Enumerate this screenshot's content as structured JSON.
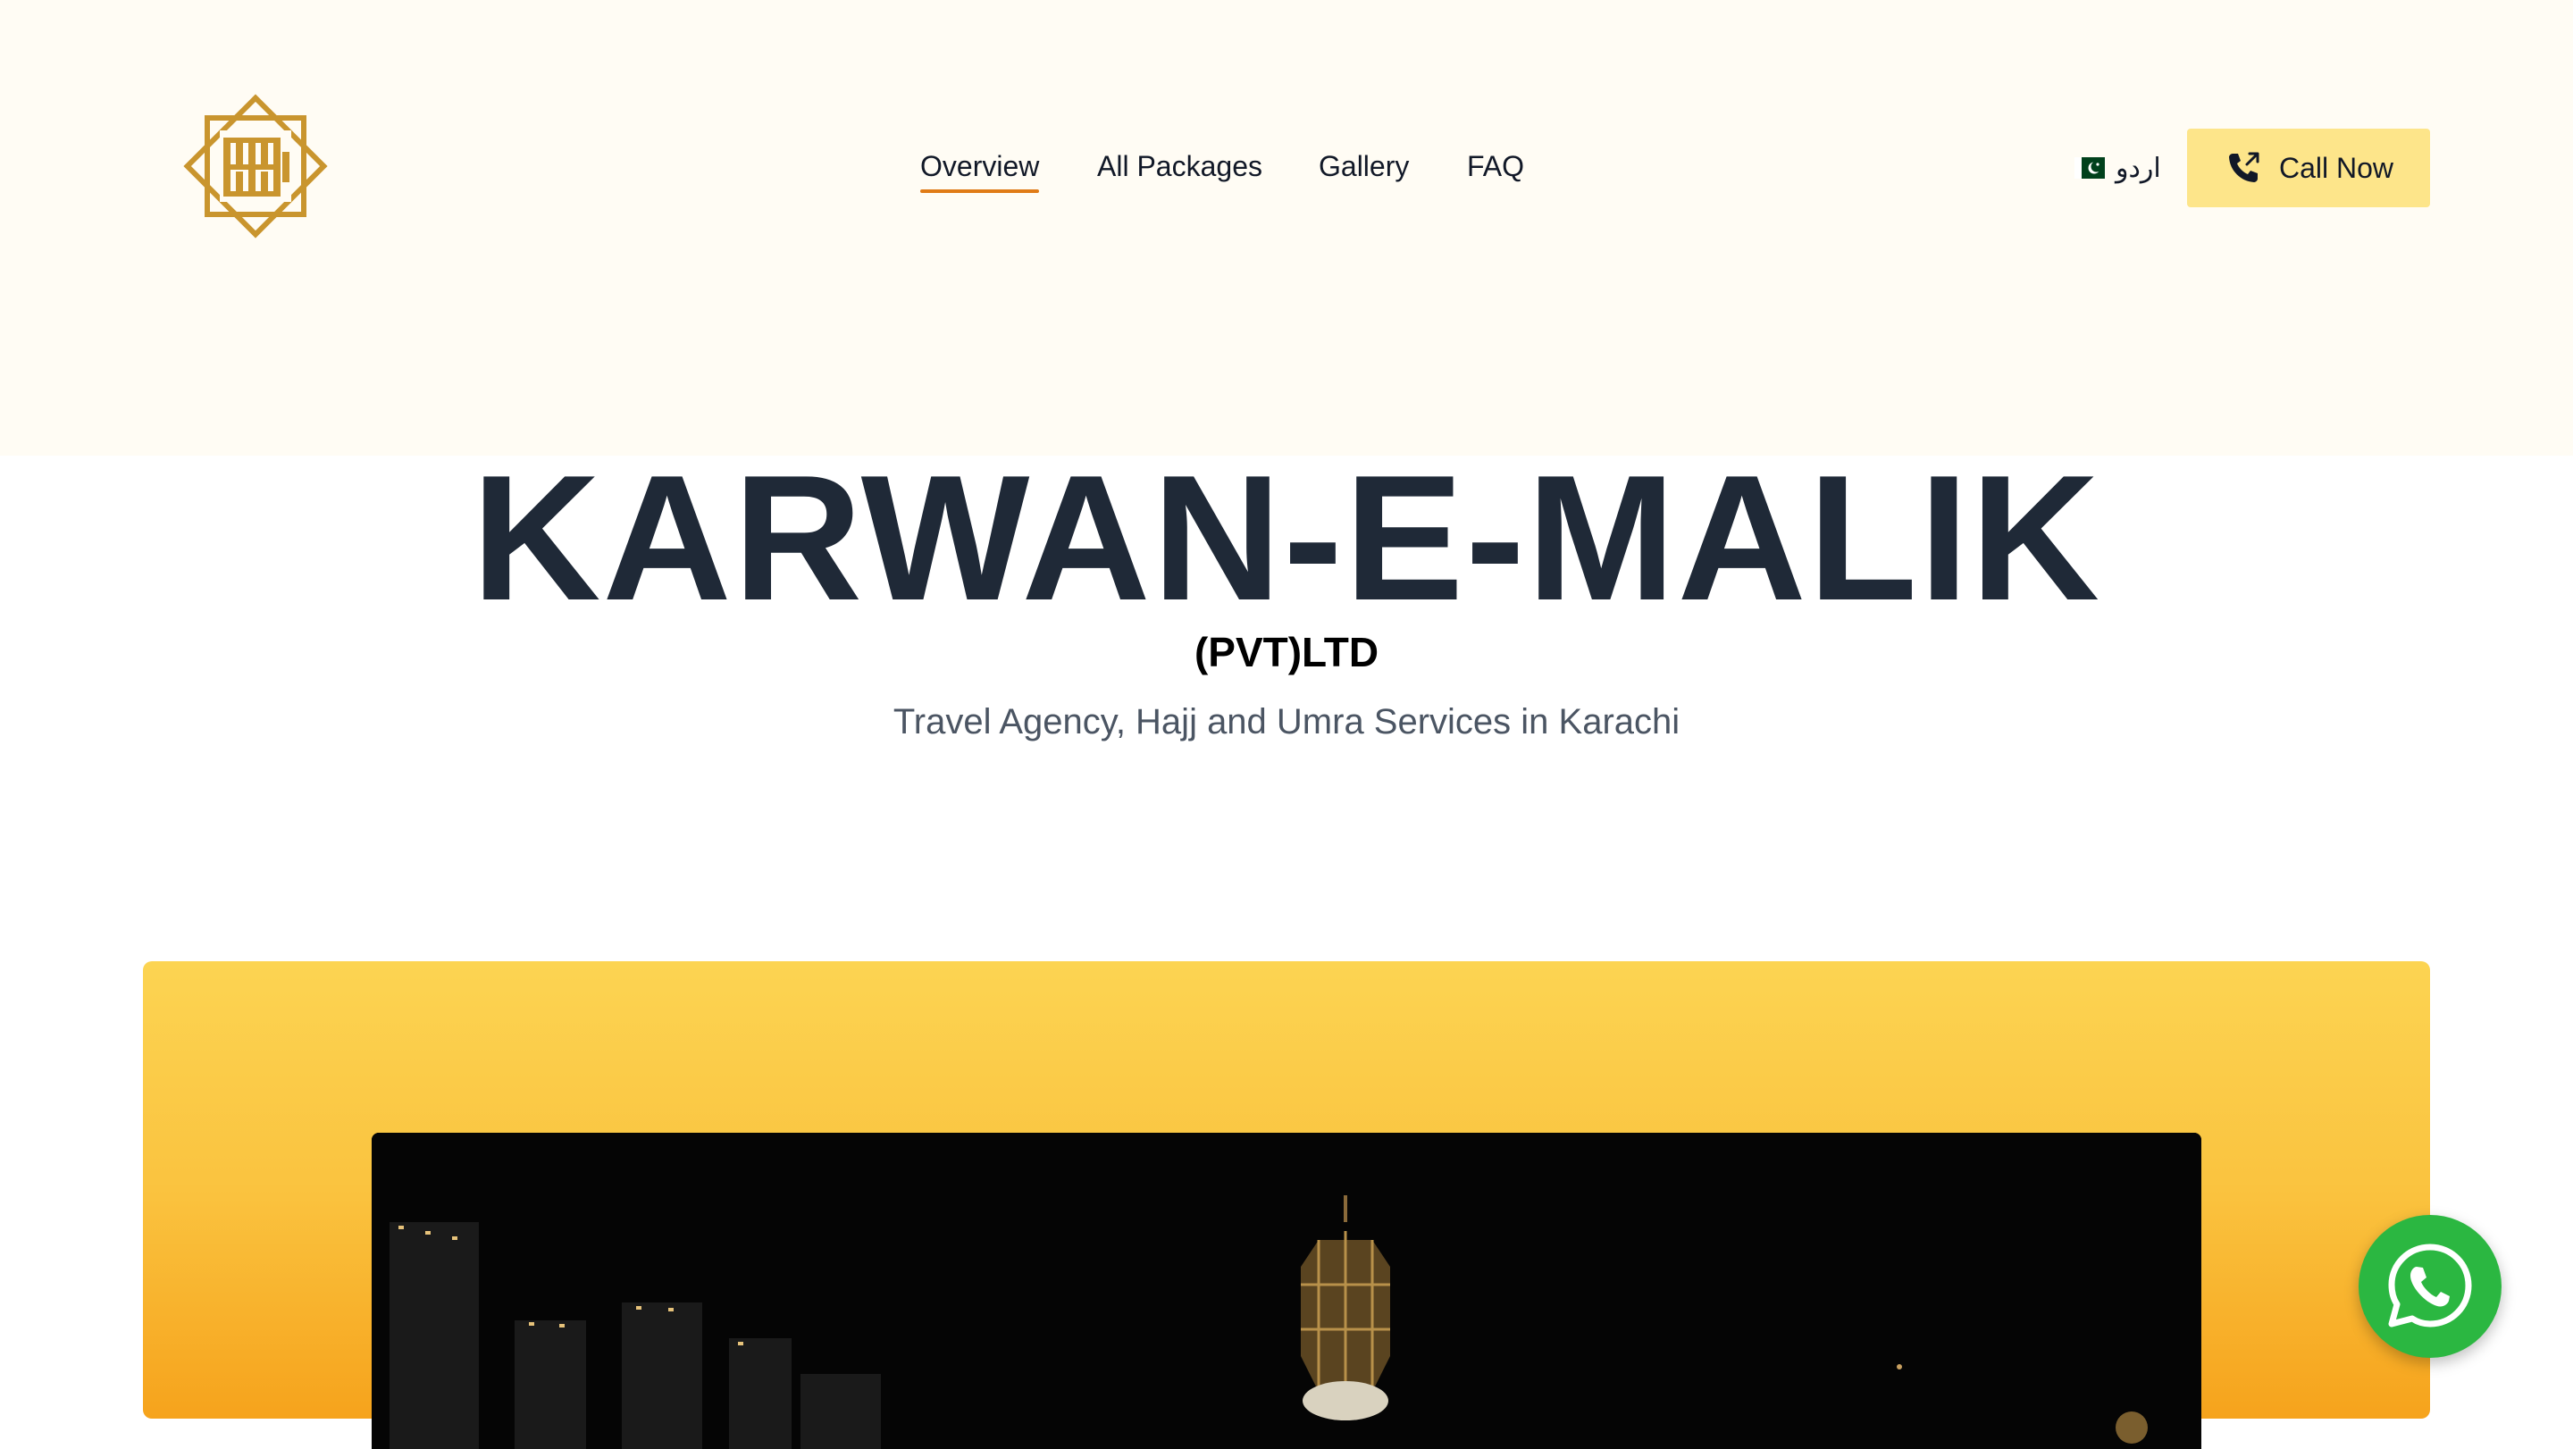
{
  "header": {
    "logo_icon": "karwan-e-malik-logo",
    "nav": [
      {
        "label": "Overview",
        "active": true
      },
      {
        "label": "All Packages",
        "active": false
      },
      {
        "label": "Gallery",
        "active": false
      },
      {
        "label": "FAQ",
        "active": false
      }
    ],
    "language": {
      "flag_icon": "pakistan-flag-icon",
      "label": "اردو"
    },
    "call_button": {
      "icon": "phone-outgoing-icon",
      "label": "Call Now"
    }
  },
  "hero": {
    "title": "KARWAN-E-MALIK",
    "subtitle": "(PVT)LTD",
    "tagline": "Travel Agency, Hajj and Umra Services in Karachi"
  },
  "banner": {
    "gradient_colors": [
      "#fcd452",
      "#f6a31c"
    ],
    "image": "night-view-clock-tower-makkah"
  },
  "floating": {
    "whatsapp_icon": "whatsapp-icon",
    "color": "#2bb741"
  },
  "colors": {
    "header_bg": "#fffcf4",
    "accent_underline": "#e07b16",
    "call_button_bg": "#fde58a",
    "title": "#1f2937",
    "logo_gold": "#c9952e"
  }
}
